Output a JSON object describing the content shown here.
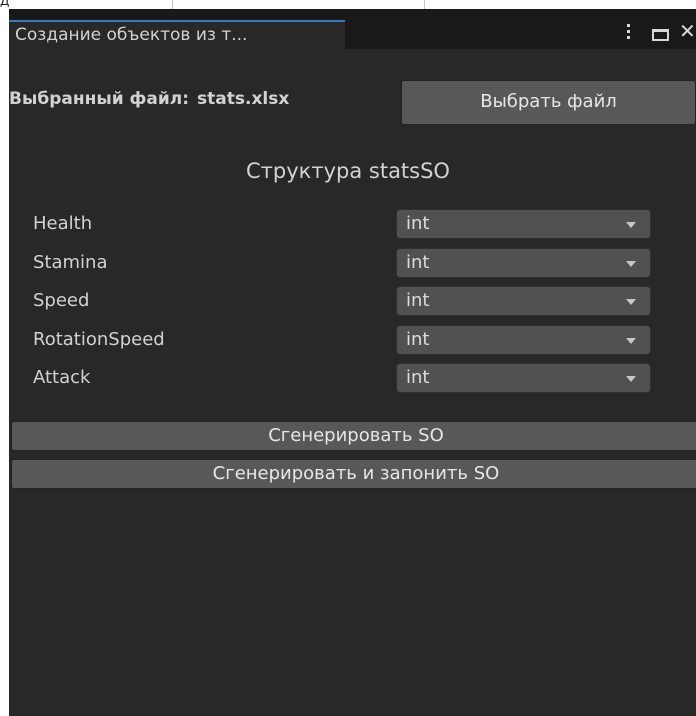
{
  "top_strip": {
    "glyph": "Д"
  },
  "window": {
    "tab_title": "Создание объектов из т...",
    "controls": [
      "kebab-menu-icon",
      "maximize-icon",
      "close-icon"
    ]
  },
  "file": {
    "label": "Выбранный файл:",
    "name": "stats.xlsx",
    "pick_button": "Выбрать файл"
  },
  "structure": {
    "title": "Структура statsSO",
    "fields": [
      {
        "name": "Health",
        "type": "int"
      },
      {
        "name": "Stamina",
        "type": "int"
      },
      {
        "name": "Speed",
        "type": "int"
      },
      {
        "name": "RotationSpeed",
        "type": "int"
      },
      {
        "name": "Attack",
        "type": "int"
      }
    ]
  },
  "actions": {
    "generate": "Сгенерировать SO",
    "generate_fill": "Сгенерировать и запонить SO"
  },
  "colors": {
    "panel_bg": "#282828",
    "tab_bar_bg": "#191919",
    "tab_accent": "#3a79bb",
    "button_bg": "#585858",
    "dropdown_bg": "#515151"
  }
}
